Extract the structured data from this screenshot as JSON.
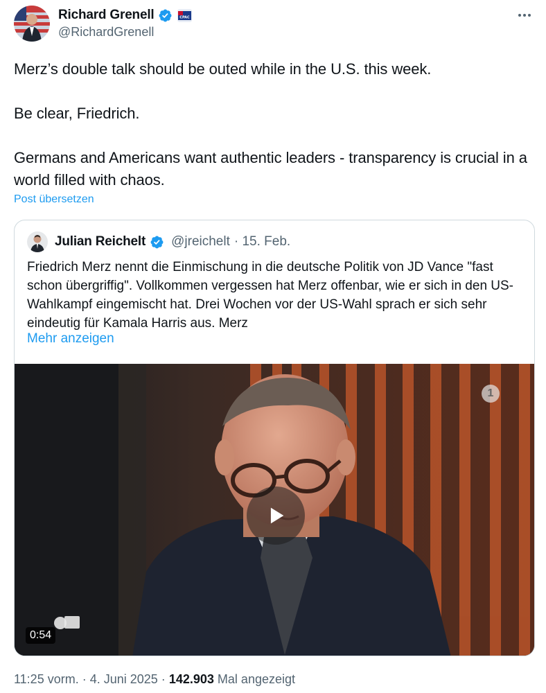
{
  "author": {
    "name": "Richard Grenell",
    "handle": "@RichardGrenell",
    "verified": true,
    "affiliation_badge": "CPAC",
    "avatar": "avatar-photo"
  },
  "tweet": {
    "lines": [
      "Merz’s double talk should be outed while in the U.S. this week.",
      "Be clear, Friedrich.",
      "Germans and Americans want authentic leaders - transparency is crucial in a world filled with chaos."
    ],
    "translate_label": "Post übersetzen"
  },
  "quoted": {
    "name": "Julian Reichelt",
    "handle": "@jreichelt",
    "date": "· 15. Feb.",
    "text": "Friedrich Merz nennt die Einmischung in die deutsche Politik von JD Vance \"fast schon übergriffig\". Vollkommen vergessen hat Merz offenbar, wie er sich in den US-Wahlkampf eingemischt hat. Drei Wochen vor der US-Wahl sprach er sich sehr eindeutig für Kamala Harris aus. Merz",
    "show_more": "Mehr anzeigen",
    "video": {
      "duration": "0:54",
      "channel_logo": "1"
    }
  },
  "meta": {
    "time": "11:25 vorm.",
    "date": "· 4. Juni 2025 ·",
    "views": "142.903",
    "views_label": "Mal angezeigt"
  },
  "colors": {
    "link": "#1d9bf0",
    "secondary_text": "#536471",
    "verified": "#1d9bf0",
    "border": "#cfd9de"
  }
}
